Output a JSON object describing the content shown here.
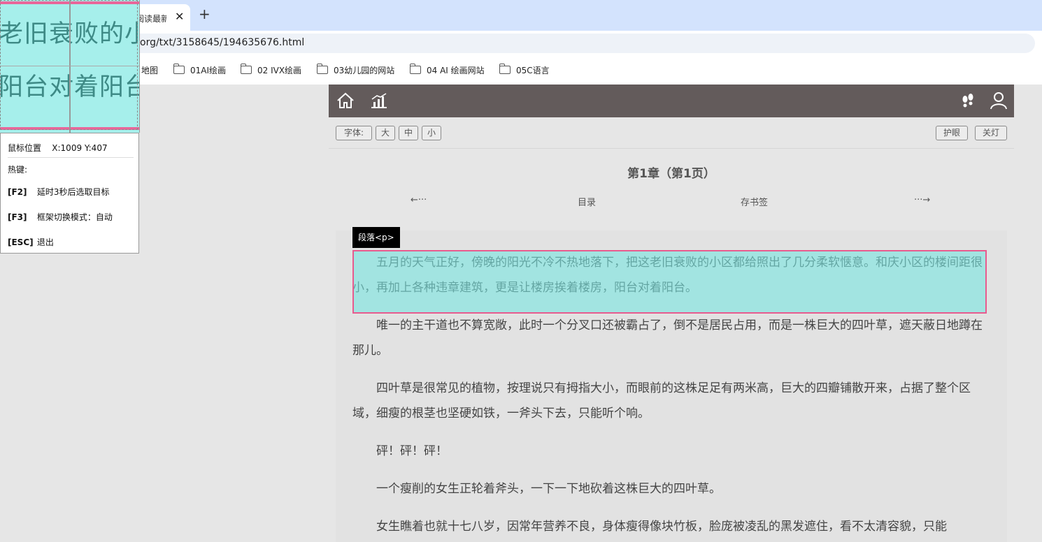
{
  "browser": {
    "tab_title": "阅读最新",
    "tab_close": "✕",
    "new_tab": "+",
    "url": "org/txt/3158645/194635676.html",
    "bookmarks": [
      {
        "label": "地图"
      },
      {
        "label": "01AI绘画"
      },
      {
        "label": "02 IVX绘画"
      },
      {
        "label": "03幼儿园的网站"
      },
      {
        "label": "04 AI 绘画网站"
      },
      {
        "label": "05C语言"
      }
    ]
  },
  "toolbar": {
    "font_label": "字体:",
    "font_large": "大",
    "font_medium": "中",
    "font_small": "小",
    "eye_care": "护眼",
    "lights_off": "关灯"
  },
  "chapter": {
    "title": "第1章（第1页）",
    "prev": "←···",
    "toc": "目录",
    "bookmark": "存书签",
    "next": "···→"
  },
  "content": {
    "paragraphs": [
      "五月的天气正好，傍晚的阳光不冷不热地落下，把这老旧衰败的小区都给照出了几分柔软惬意。和庆小区的楼间距很小，再加上各种违章建筑，更是让楼房挨着楼房，阳台对着阳台。",
      "唯一的主干道也不算宽敞，此时一个分叉口还被霸占了，倒不是居民占用，而是一株巨大的四叶草，遮天蔽日地蹲在那儿。",
      "四叶草是很常见的植物，按理说只有拇指大小，而眼前的这株足足有两米高，巨大的四瓣铺散开来，占据了整个区域，细瘦的根茎也坚硬如铁，一斧头下去，只能听个响。",
      "砰！砰！砰！",
      "一个瘦削的女生正轮着斧头，一下一下地砍着这株巨大的四叶草。",
      "女生瞧着也就十七八岁，因常年营养不良，身体瘦得像块竹板，脸庞被凌乱的黑发遮住，看不太清容貌，只能"
    ]
  },
  "inspector": {
    "element_tag": "段落<p>",
    "magnified_line_1": "老旧衰败的小",
    "magnified_line_2": "阳台对着阳台",
    "position_label": "鼠标位置",
    "position_value": "X:1009 Y:407",
    "hotkeys_title": "热键:",
    "hotkeys": [
      {
        "key": "[F2]",
        "desc": "延时3秒后选取目标"
      },
      {
        "key": "[F3]",
        "desc": "框架切换模式：自动"
      },
      {
        "key": "[ESC]",
        "desc": "退出"
      }
    ]
  },
  "colors": {
    "header_bg": "#635b5b",
    "highlight_fill": "#a6efeb",
    "highlight_border": "#e85b8e",
    "page_bg": "#e6e6e6"
  },
  "icons": [
    "home-icon",
    "chart-icon",
    "footprints-icon",
    "user-icon",
    "folder-icon"
  ]
}
